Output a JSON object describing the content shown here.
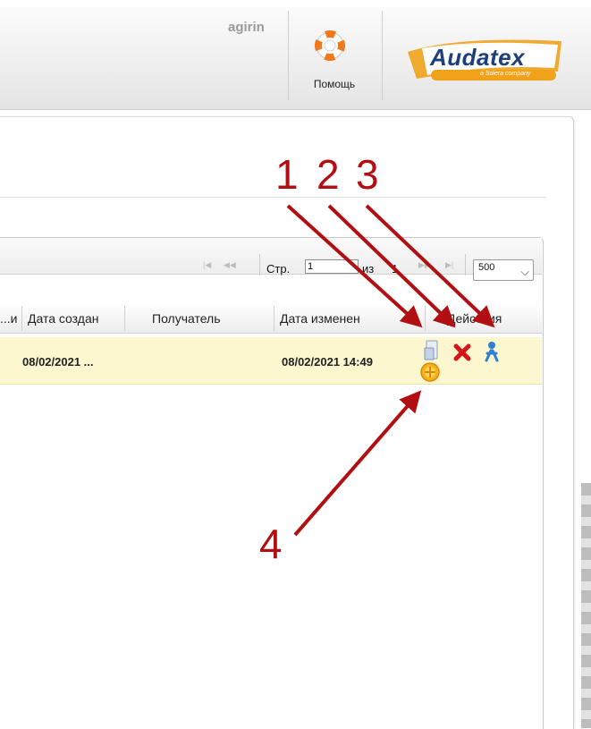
{
  "header": {
    "username": "agirin",
    "help_label": "Помощь",
    "logo_text": "Audatex",
    "logo_subtitle": "a Solera company"
  },
  "pager": {
    "page_label": "Стр.",
    "page_value": "1",
    "of_label": "из",
    "total_pages": "1",
    "page_size": "500"
  },
  "grid": {
    "columns": [
      "...и",
      "Дата создан",
      "Получатель",
      "Дата изменен",
      "Действия"
    ],
    "rows": [
      {
        "created": "08/02/2021 ...",
        "recipient": "",
        "modified": "08/02/2021 14:49"
      }
    ]
  },
  "actions": [
    "document-send-icon",
    "delete-icon",
    "user-assign-icon",
    "status-coin-icon"
  ],
  "annotations": [
    "1",
    "2",
    "3",
    "4"
  ],
  "colors": {
    "annotation": "#b20f12",
    "row_highlight": "#fdf7cf",
    "logo_blue": "#1d3f7a",
    "logo_orange": "#f0a21b"
  }
}
